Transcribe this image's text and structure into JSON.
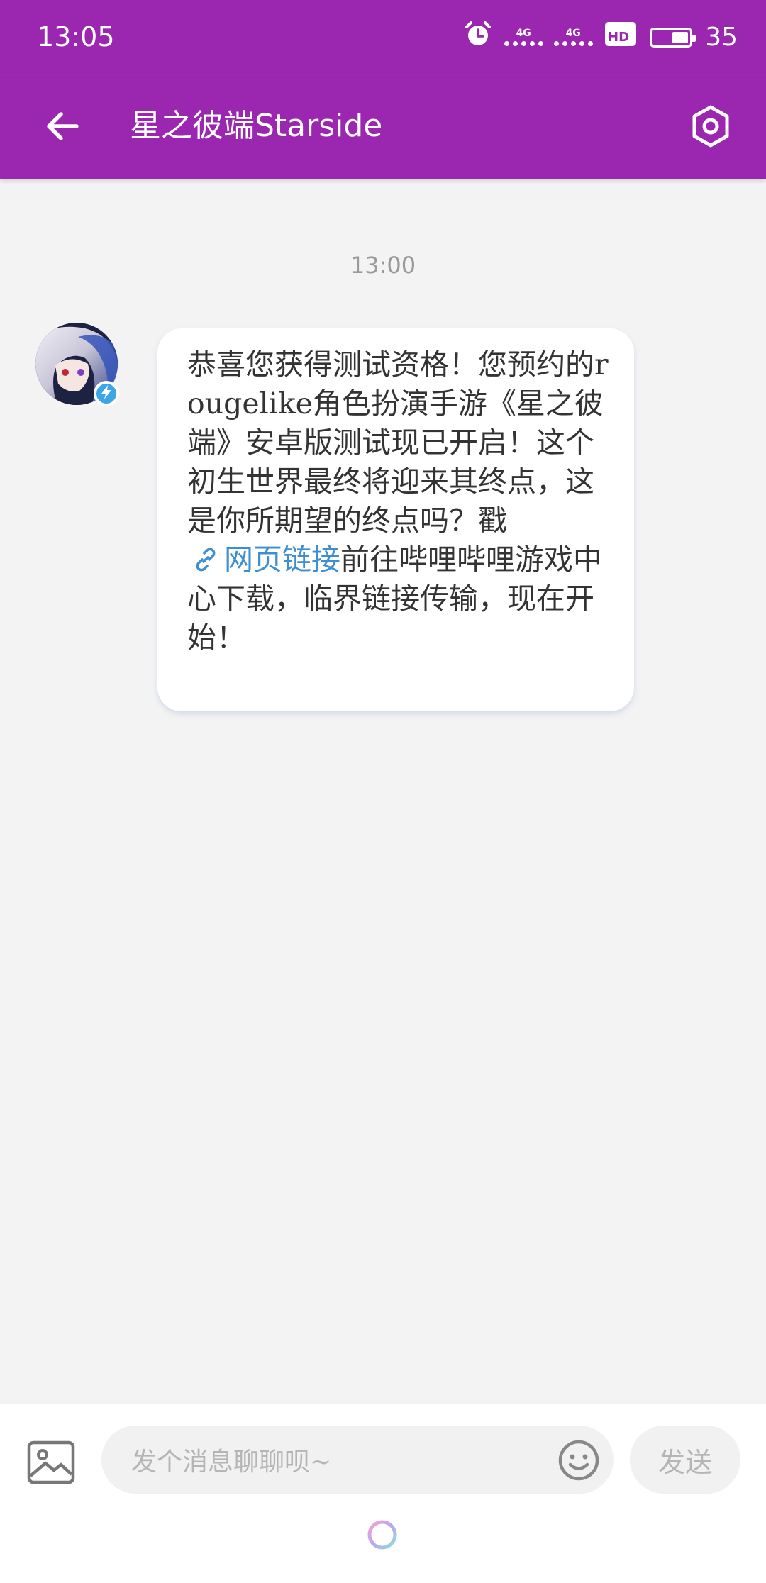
{
  "status_bar": {
    "time": "13:05",
    "signal_1_label": "4G",
    "signal_2_label": "4G",
    "hd_label": "HD",
    "battery_level": "35"
  },
  "app_bar": {
    "title": "星之彼端Starside"
  },
  "chat": {
    "timestamp": "13:00",
    "message": {
      "text_before_link": "恭喜您获得测试资格！您预约的rougelike角色扮演手游《星之彼端》安卓版测试现已开启！这个初生世界最终将迎来其终点，这是你所期望的终点吗？戳",
      "link_label": "网页链接",
      "text_after_link": "前往哔哩哔哩游戏中心下载，临界链接传输，现在开始！"
    }
  },
  "composer": {
    "placeholder": "发个消息聊聊呗~",
    "send_label": "发送"
  },
  "colors": {
    "brand": "#9b27b0",
    "link": "#3d8fd1",
    "background": "#f3f3f4"
  },
  "icons": [
    "back-arrow-icon",
    "settings-hexagon-icon",
    "alarm-icon",
    "battery-icon",
    "image-icon",
    "emoji-icon",
    "link-icon",
    "verified-bolt-icon",
    "loading-ring-icon"
  ]
}
